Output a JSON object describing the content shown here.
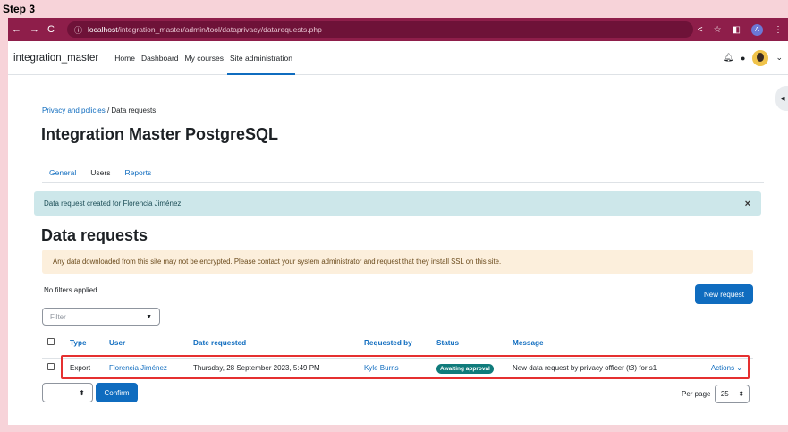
{
  "step_label": "Step 3",
  "browser": {
    "url_host": "localhost",
    "url_path": "/integration_master/admin/tool/dataprivacy/datarequests.php",
    "profile_initial": "A"
  },
  "site": {
    "brand": "integration_master",
    "nav": [
      "Home",
      "Dashboard",
      "My courses",
      "Site administration"
    ],
    "active_nav": "Site administration"
  },
  "breadcrumb": {
    "parent": "Privacy and policies",
    "separator": "/",
    "current": "Data requests"
  },
  "page_title": "Integration Master PostgreSQL",
  "tabs": [
    "General",
    "Users",
    "Reports"
  ],
  "active_tab": "Users",
  "alert": {
    "message": "Data request created for Florencia Jiménez",
    "close": "×"
  },
  "section_title": "Data requests",
  "notice": "Any data downloaded from this site may not be encrypted. Please contact your system administrator and request that they install SSL on this site.",
  "filters_text": "No filters applied",
  "new_request_label": "New request",
  "filter_placeholder": "Filter",
  "table": {
    "headers": [
      "Type",
      "User",
      "Date requested",
      "Requested by",
      "Status",
      "Message"
    ],
    "rows": [
      {
        "type": "Export",
        "user": "Florencia Jiménez",
        "date": "Thursday, 28 September 2023, 5:49 PM",
        "requested_by": "Kyle Burns",
        "status": "Awaiting approval",
        "message": "New data request by privacy officer (t3) for s1",
        "actions": "Actions"
      }
    ]
  },
  "confirm_label": "Confirm",
  "per_page_label": "Per page",
  "per_page_value": "25",
  "colors": {
    "accent": "#0f6cbf",
    "browser_bar": "#8e1e4a",
    "status_badge": "#0f7b7b",
    "highlight": "#e53030"
  }
}
